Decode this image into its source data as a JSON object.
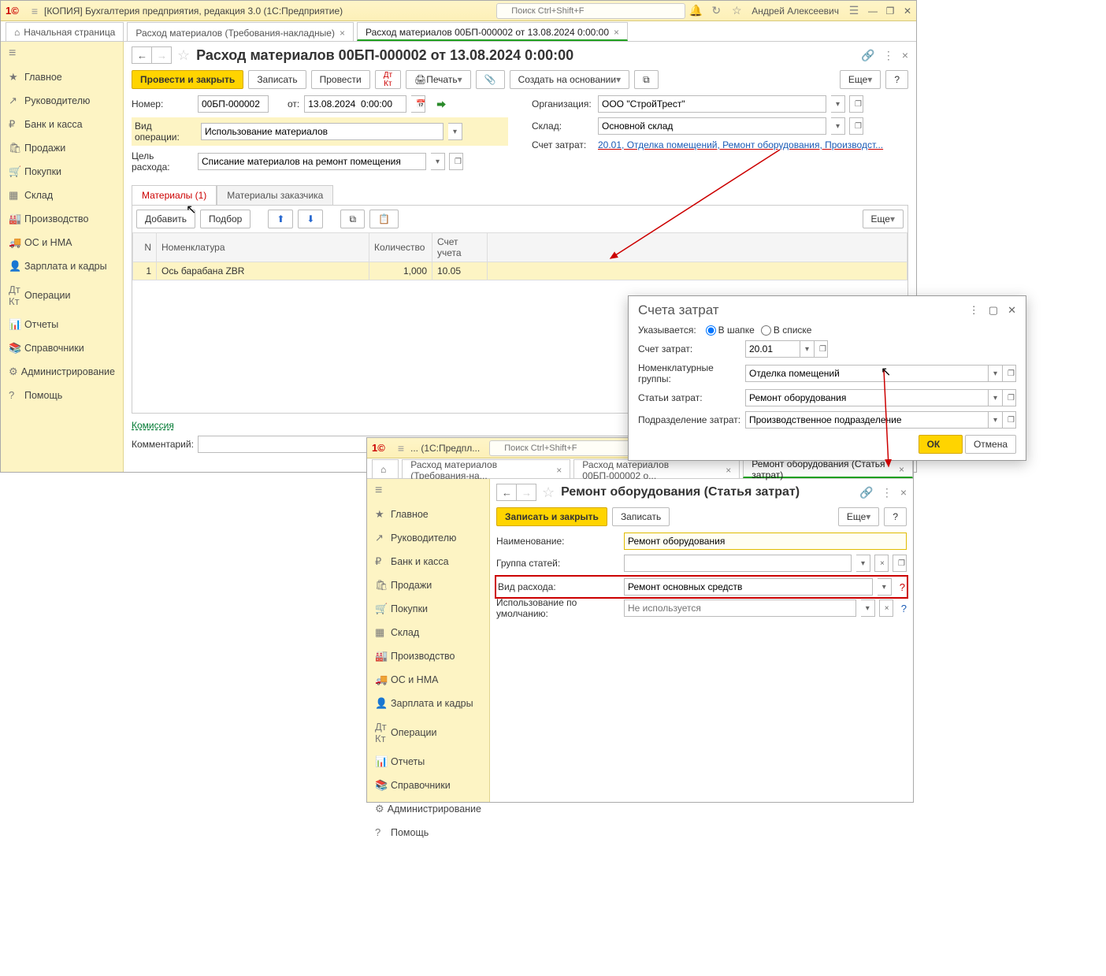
{
  "app": {
    "title_full": "[КОПИЯ] Бухгалтерия предприятия, редакция 3.0  (1С:Предприятие)",
    "title_short": "...  (1С:Предпл...",
    "search_placeholder": "Поиск Ctrl+Shift+F",
    "user": "Андрей Алексеевич"
  },
  "tabs1": {
    "home": "Начальная страница",
    "t1": "Расход материалов (Требования-накладные)",
    "t2": "Расход материалов 00БП-000002 от 13.08.2024 0:00:00"
  },
  "sidebar": [
    "Главное",
    "Руководителю",
    "Банк и касса",
    "Продажи",
    "Покупки",
    "Склад",
    "Производство",
    "ОС и НМА",
    "Зарплата и кадры",
    "Операции",
    "Отчеты",
    "Справочники",
    "Администрирование",
    "Помощь"
  ],
  "sidebar_icons": [
    "★",
    "↗",
    "₽",
    "🛍",
    "🛒",
    "▦",
    "🏭",
    "🚚",
    "👤",
    "Дт Кт",
    "📊",
    "📚",
    "⚙",
    "?"
  ],
  "doc": {
    "title": "Расход материалов 00БП-000002 от 13.08.2024 0:00:00",
    "btn_post_close": "Провести и закрыть",
    "btn_save": "Записать",
    "btn_post": "Провести",
    "btn_print": "Печать",
    "btn_create_based": "Создать на основании",
    "btn_more": "Еще",
    "lbl_number": "Номер:",
    "number": "00БП-000002",
    "lbl_from": "от:",
    "date": "13.08.2024  0:00:00",
    "lbl_org": "Организация:",
    "org": "ООО \"СтройТрест\"",
    "lbl_optype": "Вид операции:",
    "optype": "Использование материалов",
    "lbl_store": "Склад:",
    "store": "Основной склад",
    "lbl_purpose": "Цель расхода:",
    "purpose": "Списание материалов на ремонт помещения",
    "lbl_costacc": "Счет затрат:",
    "costacc_link": "20.01, Отделка помещений, Ремонт оборудования, Производст...",
    "subtab1": "Материалы (1)",
    "subtab2": "Материалы заказчика",
    "btn_add": "Добавить",
    "btn_pick": "Подбор",
    "th_n": "N",
    "th_nom": "Номенклатура",
    "th_qty": "Количество",
    "th_acc": "Счет учета",
    "row": {
      "n": "1",
      "nom": "Ось барабана ZBR",
      "qty": "1,000",
      "acc": "10.05"
    },
    "commission": "Комиссия",
    "lbl_comment": "Комментарий:"
  },
  "popup": {
    "title": "Счета затрат",
    "lbl_where": "Указывается:",
    "opt_header": "В шапке",
    "opt_list": "В списке",
    "lbl_acc": "Счет затрат:",
    "acc": "20.01",
    "lbl_nomgroup": "Номенклатурные группы:",
    "nomgroup": "Отделка помещений",
    "lbl_cost_item": "Статьи затрат:",
    "cost_item": "Ремонт оборудования",
    "lbl_division": "Подразделение затрат:",
    "division": "Производственное подразделение",
    "btn_ok": "ОК",
    "btn_cancel": "Отмена"
  },
  "tabs2": {
    "t1": "Расход материалов (Требования-на...",
    "t2": "Расход материалов 00БП-000002 о...",
    "t3": "Ремонт оборудования (Статья затрат)"
  },
  "form2": {
    "title": "Ремонт оборудования (Статья затрат)",
    "btn_save_close": "Записать и закрыть",
    "btn_save": "Записать",
    "btn_more": "Еще",
    "lbl_name": "Наименование:",
    "name": "Ремонт оборудования",
    "lbl_group": "Группа статей:",
    "group": "",
    "lbl_exptype": "Вид расхода:",
    "exptype": "Ремонт основных средств",
    "lbl_default": "Использование по умолчанию:",
    "default_ph": "Не используется"
  }
}
